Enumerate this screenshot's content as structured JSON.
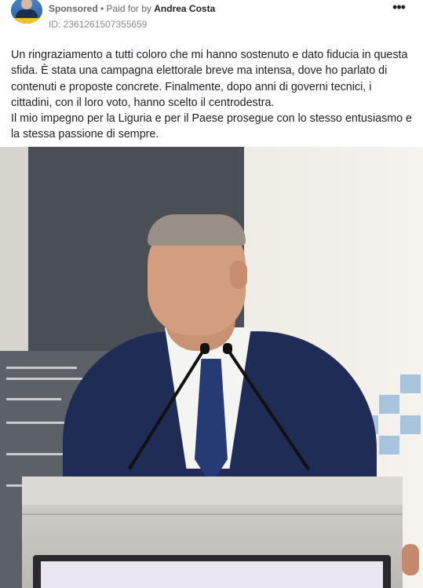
{
  "ad": {
    "sponsored": "Sponsored",
    "separator": " • ",
    "paid_for_prefix": "Paid for by ",
    "payer": "Andrea Costa",
    "id": "ID: 2361261507355659",
    "more_icon": "more-horizontal-icon"
  },
  "post": {
    "paragraphs": [
      "Un ringraziamento a tutti coloro che mi hanno sostenuto e dato fiducia in questa sfida. È stata una campagna elettorale breve ma intensa, dove ho parlato di contenuti e proposte concrete. Finalmente, dopo anni di governi tecnici, i cittadini, con il loro voto, hanno scelto il centrodestra.",
      "Il mio impegno per la Liguria e per il Paese prosegue con lo stesso entusiasmo e la stessa passione di sempre."
    ]
  },
  "colors": {
    "text": "#1c1e21",
    "secondary": "#65676b",
    "jacket": "#1f2c55"
  }
}
